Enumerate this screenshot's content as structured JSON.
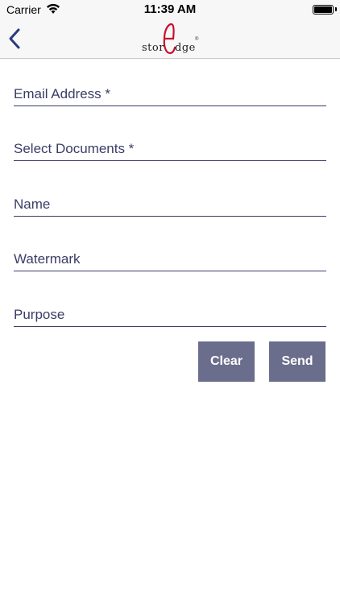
{
  "status_bar": {
    "carrier": "Carrier",
    "time": "11:39 AM",
    "wifi_icon": "wifi-icon",
    "battery_icon": "battery-icon",
    "battery_level": 1.0
  },
  "nav": {
    "back_icon": "chevron-left-icon",
    "logo": {
      "text_left": "stor",
      "text_right": "dge",
      "mark": "®",
      "accent": "#c8102e"
    }
  },
  "form": {
    "fields": [
      {
        "label": "Email Address *"
      },
      {
        "label": "Select Documents *"
      },
      {
        "label": "Name"
      },
      {
        "label": "Watermark"
      },
      {
        "label": "Purpose"
      }
    ],
    "buttons": {
      "clear": "Clear",
      "send": "Send"
    }
  },
  "colors": {
    "text": "#3b3d66",
    "button_bg": "#6b6d8c",
    "button_text": "#ffffff",
    "nav_bg": "#f7f7f7"
  }
}
